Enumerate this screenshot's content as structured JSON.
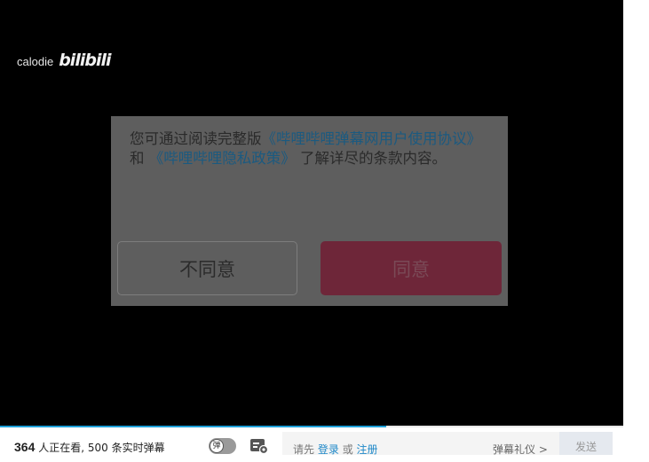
{
  "player": {
    "watermark_user": "calodie",
    "watermark_logo": "bilibili"
  },
  "dialog": {
    "text_part1": "您可通过阅读完整版",
    "link1": "《哔哩哔哩弹幕网用户使用协议》",
    "text_part2": "和",
    "link2": "《哔哩哔哩隐私政策》",
    "text_part3": "了解详尽的条款内容。",
    "disagree_label": "不同意",
    "agree_label": "同意"
  },
  "progress": {
    "fraction": 0.62,
    "color": "#1ea0d8"
  },
  "bottombar": {
    "viewer_count": "364",
    "viewer_text": "人正在看,",
    "danmaku_count": "500",
    "danmaku_text": "条实时弹幕",
    "danmaku_toggle_label": "弹",
    "danmaku_toggle_icon": "danmaku-toggle-icon",
    "danmaku_settings_icon": "danmaku-settings-icon",
    "login_prefix": "请先",
    "login_link": "登录",
    "login_or": "或",
    "register_link": "注册",
    "etiquette_label": "弹幕礼仪 >",
    "send_label": "发送"
  },
  "colors": {
    "link": "#1e88c8",
    "agree_button": "#6e2639",
    "dialog_overlay": "#5e5e5e"
  }
}
